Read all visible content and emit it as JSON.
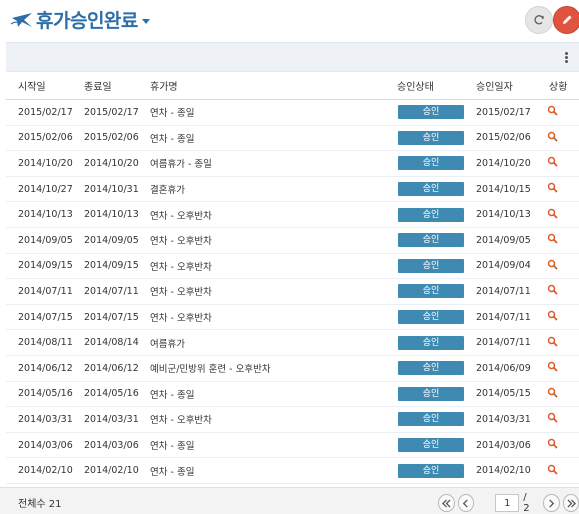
{
  "header": {
    "title": "휴가승인완료",
    "refresh_icon": "refresh-icon",
    "edit_icon": "pencil-icon"
  },
  "columns": {
    "start": "시작일",
    "end": "종료일",
    "name": "휴가명",
    "state": "승인상태",
    "date": "승인일자",
    "detail": "상황"
  },
  "rows": [
    {
      "start": "2015/02/17",
      "end": "2015/02/17",
      "name": "연차  - 종일",
      "state": "승인",
      "date": "2015/02/17"
    },
    {
      "start": "2015/02/06",
      "end": "2015/02/06",
      "name": "연차  - 종일",
      "state": "승인",
      "date": "2015/02/06"
    },
    {
      "start": "2014/10/20",
      "end": "2014/10/20",
      "name": "여름휴가  - 종일",
      "state": "승인",
      "date": "2014/10/20"
    },
    {
      "start": "2014/10/27",
      "end": "2014/10/31",
      "name": "결혼휴가",
      "state": "승인",
      "date": "2014/10/15"
    },
    {
      "start": "2014/10/13",
      "end": "2014/10/13",
      "name": "연차  - 오후반차",
      "state": "승인",
      "date": "2014/10/13"
    },
    {
      "start": "2014/09/05",
      "end": "2014/09/05",
      "name": "연차  - 오후반차",
      "state": "승인",
      "date": "2014/09/05"
    },
    {
      "start": "2014/09/15",
      "end": "2014/09/15",
      "name": "연차  - 오후반차",
      "state": "승인",
      "date": "2014/09/04"
    },
    {
      "start": "2014/07/11",
      "end": "2014/07/11",
      "name": "연차  - 오후반차",
      "state": "승인",
      "date": "2014/07/11"
    },
    {
      "start": "2014/07/15",
      "end": "2014/07/15",
      "name": "연차  - 오후반차",
      "state": "승인",
      "date": "2014/07/11"
    },
    {
      "start": "2014/08/11",
      "end": "2014/08/14",
      "name": "여름휴가",
      "state": "승인",
      "date": "2014/07/11"
    },
    {
      "start": "2014/06/12",
      "end": "2014/06/12",
      "name": "예비군/민방위 훈련  - 오후반차",
      "state": "승인",
      "date": "2014/06/09"
    },
    {
      "start": "2014/05/16",
      "end": "2014/05/16",
      "name": "연차  - 종일",
      "state": "승인",
      "date": "2014/05/15"
    },
    {
      "start": "2014/03/31",
      "end": "2014/03/31",
      "name": "연차  - 오후반차",
      "state": "승인",
      "date": "2014/03/31"
    },
    {
      "start": "2014/03/06",
      "end": "2014/03/06",
      "name": "연차  - 종일",
      "state": "승인",
      "date": "2014/03/06"
    },
    {
      "start": "2014/02/10",
      "end": "2014/02/10",
      "name": "연차  - 종일",
      "state": "승인",
      "date": "2014/02/10"
    }
  ],
  "footer": {
    "total": "전체수 21",
    "page_value": "1",
    "page_sep": "/",
    "page_total": "2"
  },
  "colors": {
    "accent": "#2d6ea8",
    "badge": "#3e8ab3",
    "edit_button": "#e0533f",
    "detail_icon": "#e05a2a"
  }
}
